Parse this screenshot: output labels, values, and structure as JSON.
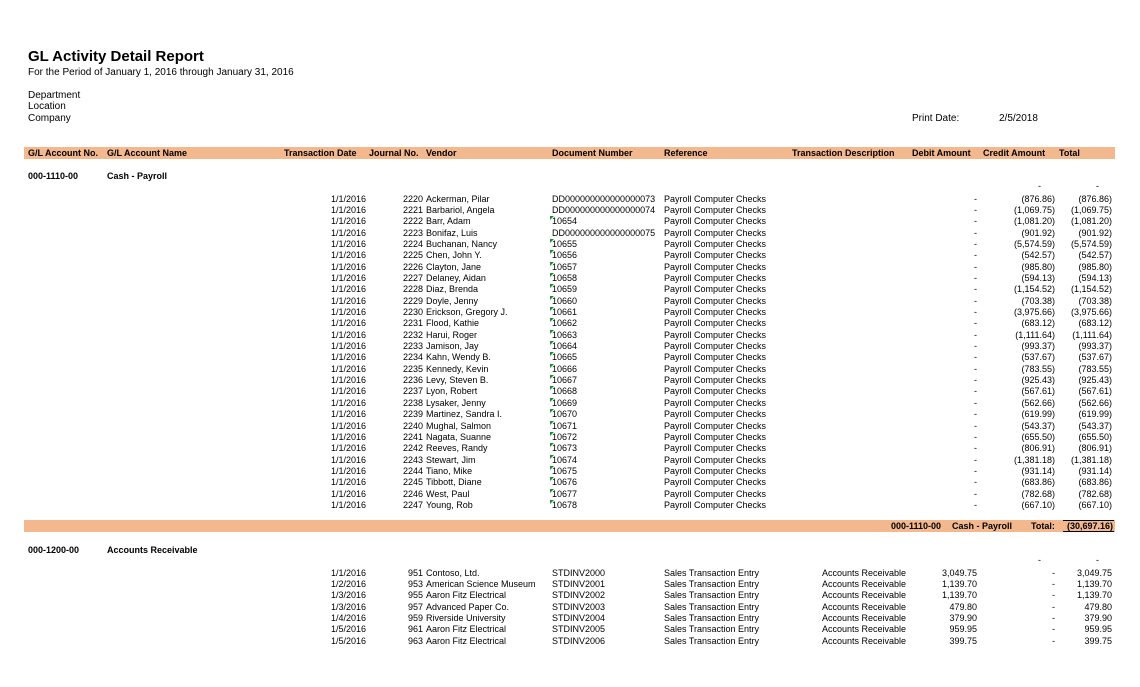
{
  "report": {
    "title": "GL Activity Detail Report",
    "period": "For the Period of January 1, 2016 through January 31, 2016",
    "department_label": "Department",
    "location_label": "Location",
    "company_label": "Company",
    "print_date_label": "Print Date:",
    "print_date_value": "2/5/2018"
  },
  "colors": {
    "header_band": "#f4b88e",
    "marker": "#1a8f2a"
  },
  "columns": {
    "account_no": "G/L Account No.",
    "account_name": "G/L Account Name",
    "transaction_date": "Transaction Date",
    "journal_no": "Journal No.",
    "vendor": "Vendor",
    "document_number": "Document Number",
    "reference": "Reference",
    "transaction_description": "Transaction Description",
    "debit_amount": "Debit Amount",
    "credit_amount": "Credit Amount",
    "total": "Total"
  },
  "accounts": [
    {
      "number": "000-1110-00",
      "name": "Cash - Payroll",
      "opening_credit": "-",
      "opening_total": "-",
      "rows": [
        {
          "date": "1/1/2016",
          "journal": "2220",
          "vendor": "Ackerman, Pilar",
          "doc": "DD000000000000000073",
          "marker": false,
          "reference": "Payroll Computer Checks",
          "description": "",
          "debit": "-",
          "credit": "(876.86)",
          "total": "(876.86)"
        },
        {
          "date": "1/1/2016",
          "journal": "2221",
          "vendor": "Barbariol, Angela",
          "doc": "DD000000000000000074",
          "marker": false,
          "reference": "Payroll Computer Checks",
          "description": "",
          "debit": "-",
          "credit": "(1,069.75)",
          "total": "(1,069.75)"
        },
        {
          "date": "1/1/2016",
          "journal": "2222",
          "vendor": "Barr, Adam",
          "doc": "10654",
          "marker": true,
          "reference": "Payroll Computer Checks",
          "description": "",
          "debit": "-",
          "credit": "(1,081.20)",
          "total": "(1,081.20)"
        },
        {
          "date": "1/1/2016",
          "journal": "2223",
          "vendor": "Bonifaz, Luis",
          "doc": "DD000000000000000075",
          "marker": false,
          "reference": "Payroll Computer Checks",
          "description": "",
          "debit": "-",
          "credit": "(901.92)",
          "total": "(901.92)"
        },
        {
          "date": "1/1/2016",
          "journal": "2224",
          "vendor": "Buchanan, Nancy",
          "doc": "10655",
          "marker": true,
          "reference": "Payroll Computer Checks",
          "description": "",
          "debit": "-",
          "credit": "(5,574.59)",
          "total": "(5,574.59)"
        },
        {
          "date": "1/1/2016",
          "journal": "2225",
          "vendor": "Chen, John Y.",
          "doc": "10656",
          "marker": true,
          "reference": "Payroll Computer Checks",
          "description": "",
          "debit": "-",
          "credit": "(542.57)",
          "total": "(542.57)"
        },
        {
          "date": "1/1/2016",
          "journal": "2226",
          "vendor": "Clayton, Jane",
          "doc": "10657",
          "marker": true,
          "reference": "Payroll Computer Checks",
          "description": "",
          "debit": "-",
          "credit": "(985.80)",
          "total": "(985.80)"
        },
        {
          "date": "1/1/2016",
          "journal": "2227",
          "vendor": "Delaney, Aidan",
          "doc": "10658",
          "marker": true,
          "reference": "Payroll Computer Checks",
          "description": "",
          "debit": "-",
          "credit": "(594.13)",
          "total": "(594.13)"
        },
        {
          "date": "1/1/2016",
          "journal": "2228",
          "vendor": "Diaz, Brenda",
          "doc": "10659",
          "marker": true,
          "reference": "Payroll Computer Checks",
          "description": "",
          "debit": "-",
          "credit": "(1,154.52)",
          "total": "(1,154.52)"
        },
        {
          "date": "1/1/2016",
          "journal": "2229",
          "vendor": "Doyle, Jenny",
          "doc": "10660",
          "marker": true,
          "reference": "Payroll Computer Checks",
          "description": "",
          "debit": "-",
          "credit": "(703.38)",
          "total": "(703.38)"
        },
        {
          "date": "1/1/2016",
          "journal": "2230",
          "vendor": "Erickson, Gregory J.",
          "doc": "10661",
          "marker": true,
          "reference": "Payroll Computer Checks",
          "description": "",
          "debit": "-",
          "credit": "(3,975.66)",
          "total": "(3,975.66)"
        },
        {
          "date": "1/1/2016",
          "journal": "2231",
          "vendor": "Flood, Kathie",
          "doc": "10662",
          "marker": true,
          "reference": "Payroll Computer Checks",
          "description": "",
          "debit": "-",
          "credit": "(683.12)",
          "total": "(683.12)"
        },
        {
          "date": "1/1/2016",
          "journal": "2232",
          "vendor": "Harui, Roger",
          "doc": "10663",
          "marker": true,
          "reference": "Payroll Computer Checks",
          "description": "",
          "debit": "-",
          "credit": "(1,111.64)",
          "total": "(1,111.64)"
        },
        {
          "date": "1/1/2016",
          "journal": "2233",
          "vendor": "Jamison, Jay",
          "doc": "10664",
          "marker": true,
          "reference": "Payroll Computer Checks",
          "description": "",
          "debit": "-",
          "credit": "(993.37)",
          "total": "(993.37)"
        },
        {
          "date": "1/1/2016",
          "journal": "2234",
          "vendor": "Kahn, Wendy B.",
          "doc": "10665",
          "marker": true,
          "reference": "Payroll Computer Checks",
          "description": "",
          "debit": "-",
          "credit": "(537.67)",
          "total": "(537.67)"
        },
        {
          "date": "1/1/2016",
          "journal": "2235",
          "vendor": "Kennedy, Kevin",
          "doc": "10666",
          "marker": true,
          "reference": "Payroll Computer Checks",
          "description": "",
          "debit": "-",
          "credit": "(783.55)",
          "total": "(783.55)"
        },
        {
          "date": "1/1/2016",
          "journal": "2236",
          "vendor": "Levy, Steven B.",
          "doc": "10667",
          "marker": true,
          "reference": "Payroll Computer Checks",
          "description": "",
          "debit": "-",
          "credit": "(925.43)",
          "total": "(925.43)"
        },
        {
          "date": "1/1/2016",
          "journal": "2237",
          "vendor": "Lyon, Robert",
          "doc": "10668",
          "marker": true,
          "reference": "Payroll Computer Checks",
          "description": "",
          "debit": "-",
          "credit": "(567.61)",
          "total": "(567.61)"
        },
        {
          "date": "1/1/2016",
          "journal": "2238",
          "vendor": "Lysaker, Jenny",
          "doc": "10669",
          "marker": true,
          "reference": "Payroll Computer Checks",
          "description": "",
          "debit": "-",
          "credit": "(562.66)",
          "total": "(562.66)"
        },
        {
          "date": "1/1/2016",
          "journal": "2239",
          "vendor": "Martinez, Sandra I.",
          "doc": "10670",
          "marker": true,
          "reference": "Payroll Computer Checks",
          "description": "",
          "debit": "-",
          "credit": "(619.99)",
          "total": "(619.99)"
        },
        {
          "date": "1/1/2016",
          "journal": "2240",
          "vendor": "Mughal, Salmon",
          "doc": "10671",
          "marker": true,
          "reference": "Payroll Computer Checks",
          "description": "",
          "debit": "-",
          "credit": "(543.37)",
          "total": "(543.37)"
        },
        {
          "date": "1/1/2016",
          "journal": "2241",
          "vendor": "Nagata, Suanne",
          "doc": "10672",
          "marker": true,
          "reference": "Payroll Computer Checks",
          "description": "",
          "debit": "-",
          "credit": "(655.50)",
          "total": "(655.50)"
        },
        {
          "date": "1/1/2016",
          "journal": "2242",
          "vendor": "Reeves, Randy",
          "doc": "10673",
          "marker": true,
          "reference": "Payroll Computer Checks",
          "description": "",
          "debit": "-",
          "credit": "(806.91)",
          "total": "(806.91)"
        },
        {
          "date": "1/1/2016",
          "journal": "2243",
          "vendor": "Stewart, Jim",
          "doc": "10674",
          "marker": true,
          "reference": "Payroll Computer Checks",
          "description": "",
          "debit": "-",
          "credit": "(1,381.18)",
          "total": "(1,381.18)"
        },
        {
          "date": "1/1/2016",
          "journal": "2244",
          "vendor": "Tiano, Mike",
          "doc": "10675",
          "marker": true,
          "reference": "Payroll Computer Checks",
          "description": "",
          "debit": "-",
          "credit": "(931.14)",
          "total": "(931.14)"
        },
        {
          "date": "1/1/2016",
          "journal": "2245",
          "vendor": "Tibbott, Diane",
          "doc": "10676",
          "marker": true,
          "reference": "Payroll Computer Checks",
          "description": "",
          "debit": "-",
          "credit": "(683.86)",
          "total": "(683.86)"
        },
        {
          "date": "1/1/2016",
          "journal": "2246",
          "vendor": "West, Paul",
          "doc": "10677",
          "marker": true,
          "reference": "Payroll Computer Checks",
          "description": "",
          "debit": "-",
          "credit": "(782.68)",
          "total": "(782.68)"
        },
        {
          "date": "1/1/2016",
          "journal": "2247",
          "vendor": "Young, Rob",
          "doc": "10678",
          "marker": true,
          "reference": "Payroll Computer Checks",
          "description": "",
          "debit": "-",
          "credit": "(667.10)",
          "total": "(667.10)"
        }
      ],
      "subtotal": {
        "account_number": "000-1110-00",
        "account_name": "Cash - Payroll",
        "label": "Total:",
        "value": "(30,697.16)"
      }
    },
    {
      "number": "000-1200-00",
      "name": "Accounts Receivable",
      "opening_credit": "-",
      "opening_total": "-",
      "rows": [
        {
          "date": "1/1/2016",
          "journal": "951",
          "vendor": "Contoso, Ltd.",
          "doc": "STDINV2000",
          "marker": false,
          "reference": "Sales Transaction Entry",
          "description": "Accounts Receivable",
          "debit": "3,049.75",
          "credit": "-",
          "total": "3,049.75"
        },
        {
          "date": "1/2/2016",
          "journal": "953",
          "vendor": "American Science Museum",
          "doc": "STDINV2001",
          "marker": false,
          "reference": "Sales Transaction Entry",
          "description": "Accounts Receivable",
          "debit": "1,139.70",
          "credit": "-",
          "total": "1,139.70"
        },
        {
          "date": "1/3/2016",
          "journal": "955",
          "vendor": "Aaron Fitz Electrical",
          "doc": "STDINV2002",
          "marker": false,
          "reference": "Sales Transaction Entry",
          "description": "Accounts Receivable",
          "debit": "1,139.70",
          "credit": "-",
          "total": "1,139.70"
        },
        {
          "date": "1/3/2016",
          "journal": "957",
          "vendor": "Advanced Paper Co.",
          "doc": "STDINV2003",
          "marker": false,
          "reference": "Sales Transaction Entry",
          "description": "Accounts Receivable",
          "debit": "479.80",
          "credit": "-",
          "total": "479.80"
        },
        {
          "date": "1/4/2016",
          "journal": "959",
          "vendor": "Riverside University",
          "doc": "STDINV2004",
          "marker": false,
          "reference": "Sales Transaction Entry",
          "description": "Accounts Receivable",
          "debit": "379.90",
          "credit": "-",
          "total": "379.90"
        },
        {
          "date": "1/5/2016",
          "journal": "961",
          "vendor": "Aaron Fitz Electrical",
          "doc": "STDINV2005",
          "marker": false,
          "reference": "Sales Transaction Entry",
          "description": "Accounts Receivable",
          "debit": "959.95",
          "credit": "-",
          "total": "959.95"
        },
        {
          "date": "1/5/2016",
          "journal": "963",
          "vendor": "Aaron Fitz Electrical",
          "doc": "STDINV2006",
          "marker": false,
          "reference": "Sales Transaction Entry",
          "description": "Accounts Receivable",
          "debit": "399.75",
          "credit": "-",
          "total": "399.75"
        }
      ]
    }
  ]
}
